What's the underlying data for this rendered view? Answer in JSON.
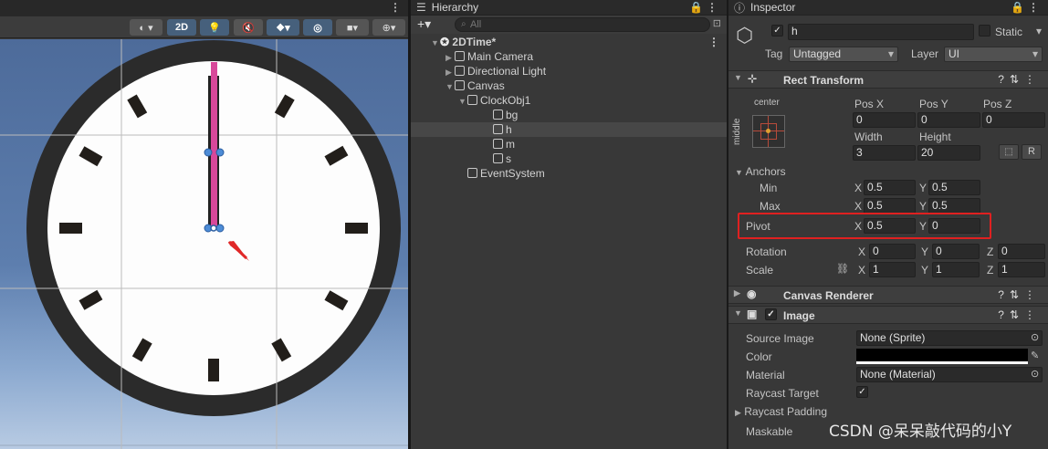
{
  "scene": {
    "toolbar": {
      "btn_2d": "2D"
    }
  },
  "hierarchy": {
    "tab_title": "Hierarchy",
    "search_placeholder": "All",
    "items": [
      {
        "label": "2DTime*"
      },
      {
        "label": "Main Camera"
      },
      {
        "label": "Directional Light"
      },
      {
        "label": "Canvas"
      },
      {
        "label": "ClockObj1"
      },
      {
        "label": "bg"
      },
      {
        "label": "h"
      },
      {
        "label": "m"
      },
      {
        "label": "s"
      },
      {
        "label": "EventSystem"
      }
    ]
  },
  "inspector": {
    "tab_title": "Inspector",
    "object_name": "h",
    "static_label": "Static",
    "tag_label": "Tag",
    "tag_value": "Untagged",
    "layer_label": "Layer",
    "layer_value": "UI",
    "rect_transform": {
      "title": "Rect Transform",
      "anchor_preset_top": "center",
      "anchor_preset_side": "middle",
      "pos_x_label": "Pos X",
      "pos_x": "0",
      "pos_y_label": "Pos Y",
      "pos_y": "0",
      "pos_z_label": "Pos Z",
      "pos_z": "0",
      "width_label": "Width",
      "width": "3",
      "height_label": "Height",
      "height": "20",
      "r_button": "R",
      "anchors_label": "Anchors",
      "min_label": "Min",
      "min_x": "0.5",
      "min_y": "0.5",
      "max_label": "Max",
      "max_x": "0.5",
      "max_y": "0.5",
      "pivot_label": "Pivot",
      "pivot_x": "0.5",
      "pivot_y": "0",
      "rotation_label": "Rotation",
      "rot_x": "0",
      "rot_y": "0",
      "rot_z": "0",
      "scale_label": "Scale",
      "scale_x": "1",
      "scale_y": "1",
      "scale_z": "1",
      "x": "X",
      "y": "Y",
      "z": "Z"
    },
    "canvas_renderer": {
      "title": "Canvas Renderer"
    },
    "image": {
      "title": "Image",
      "source_image_label": "Source Image",
      "source_image": "None (Sprite)",
      "color_label": "Color",
      "material_label": "Material",
      "material": "None (Material)",
      "raycast_target_label": "Raycast Target",
      "raycast_padding_label": "Raycast Padding",
      "maskable_label": "Maskable"
    },
    "highlight_color": "#e02020"
  },
  "watermark": "CSDN @呆呆敲代码的小Y"
}
